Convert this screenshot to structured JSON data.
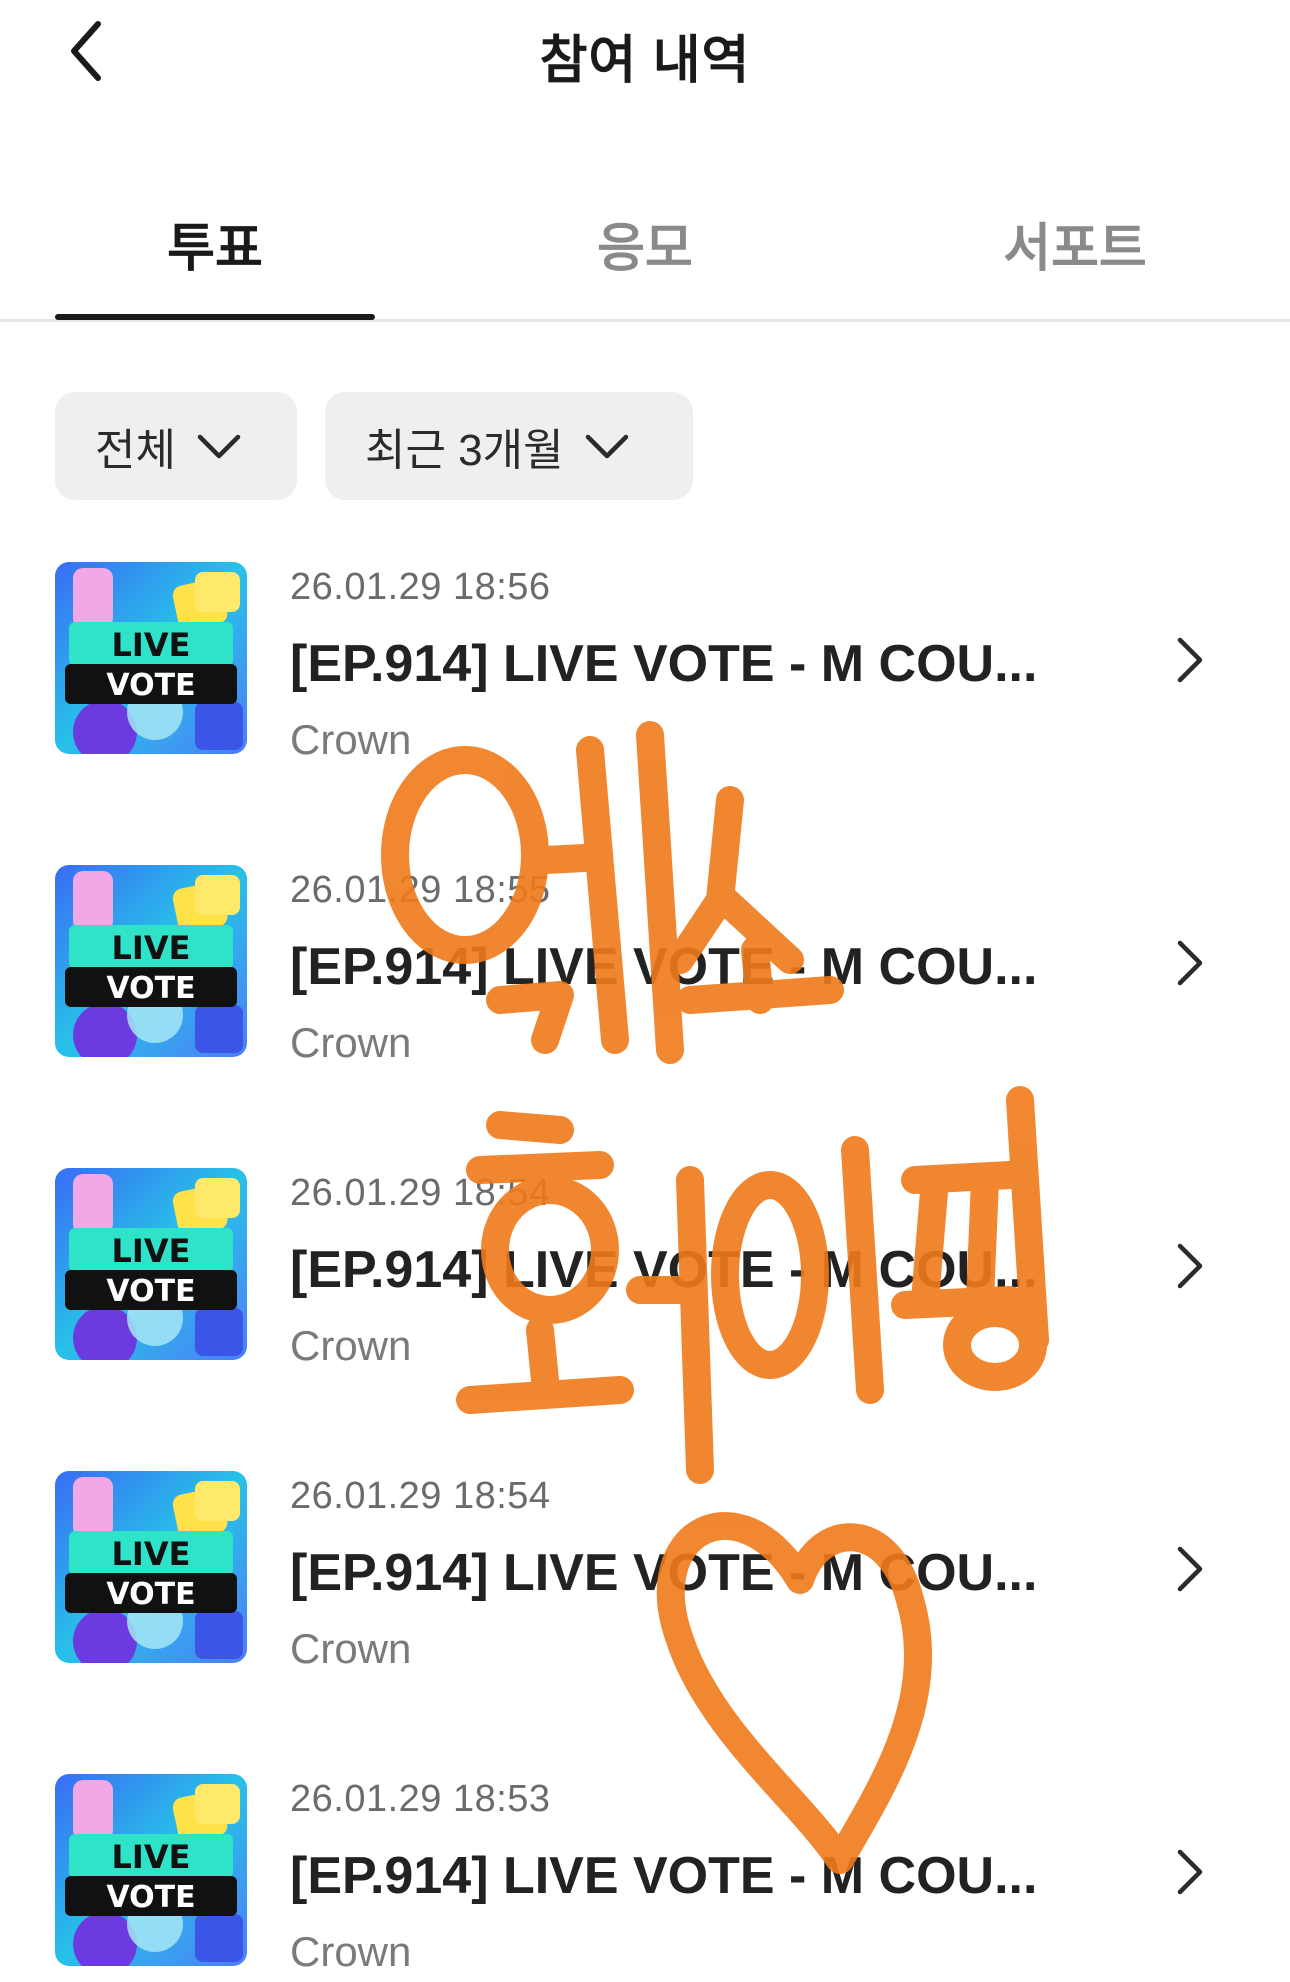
{
  "header": {
    "title": "참여 내역"
  },
  "tabs": [
    {
      "label": "투표",
      "active": true
    },
    {
      "label": "응모",
      "active": false
    },
    {
      "label": "서포트",
      "active": false
    }
  ],
  "filters": [
    {
      "label": "전체"
    },
    {
      "label": "최근 3개월"
    }
  ],
  "items": [
    {
      "date": "26.01.29 18:56",
      "title": "[EP.914] LIVE VOTE - M COU...",
      "sub": "Crown",
      "thumb_line1": "LIVE",
      "thumb_line2": "VOTE"
    },
    {
      "date": "26.01.29 18:55",
      "title": "[EP.914] LIVE VOTE - M COU...",
      "sub": "Crown",
      "thumb_line1": "LIVE",
      "thumb_line2": "VOTE"
    },
    {
      "date": "26.01.29 18:54",
      "title": "[EP.914] LIVE VOTE - M COU...",
      "sub": "Crown",
      "thumb_line1": "LIVE",
      "thumb_line2": "VOTE"
    },
    {
      "date": "26.01.29 18:54",
      "title": "[EP.914] LIVE VOTE - M COU...",
      "sub": "Crown",
      "thumb_line1": "LIVE",
      "thumb_line2": "VOTE"
    },
    {
      "date": "26.01.29 18:53",
      "title": "[EP.914] LIVE VOTE - M COU...",
      "sub": "Crown",
      "thumb_line1": "LIVE",
      "thumb_line2": "VOTE"
    }
  ],
  "overlay": {
    "handwriting": "엑소 화이팅",
    "color": "#f07a1a"
  },
  "colors": {
    "accent": "#1a1a1a",
    "chip_bg": "#eeeff1",
    "muted": "#8a8a8a"
  },
  "icons": {
    "back": "chevron-left-icon",
    "filter": "chevron-down-icon",
    "row": "chevron-right-icon"
  }
}
